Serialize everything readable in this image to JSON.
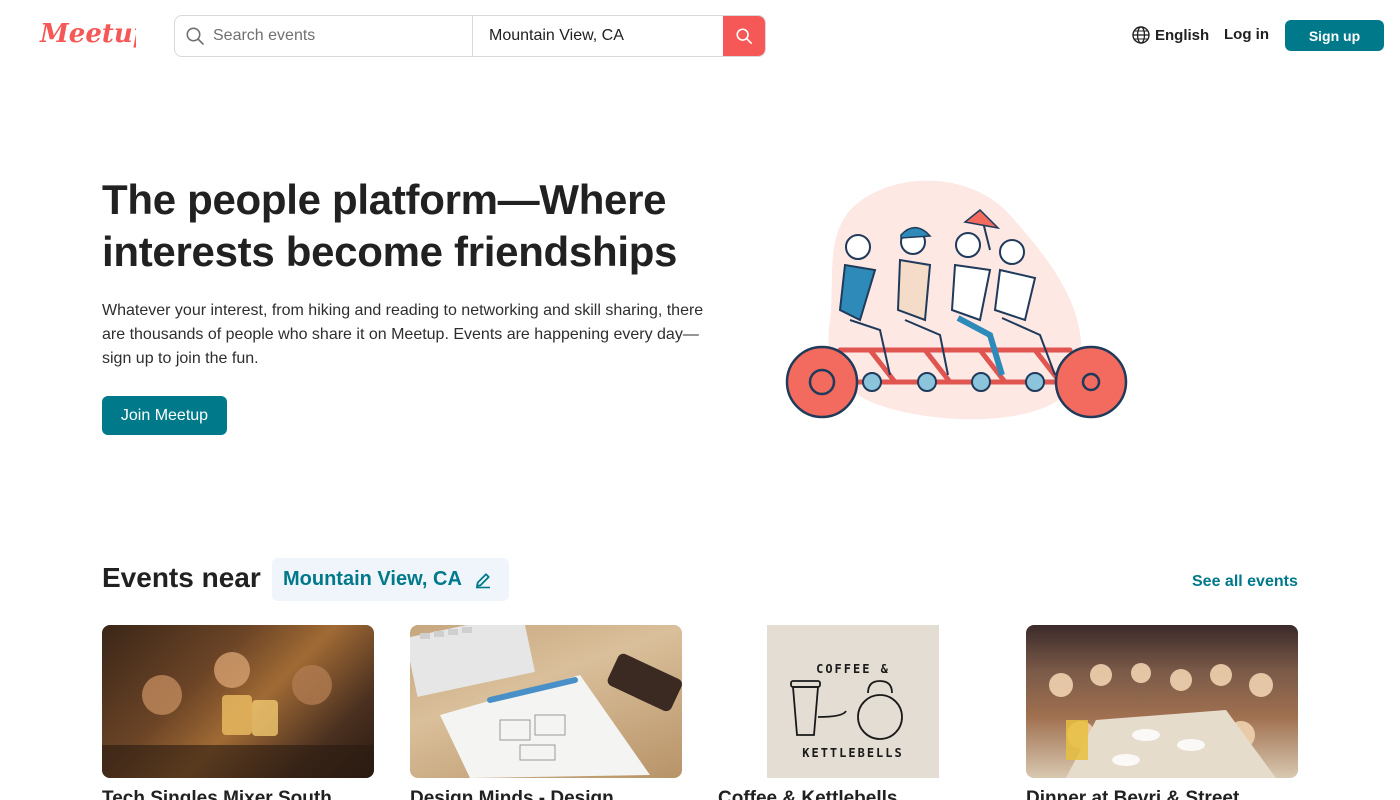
{
  "header": {
    "logo_text": "Meetup",
    "search_placeholder": "Search events",
    "location_value": "Mountain View, CA",
    "language_label": "English",
    "login_label": "Log in",
    "signup_label": "Sign up"
  },
  "hero": {
    "title": "The people platform—Where interests become friendships",
    "subtitle": "Whatever your interest, from hiking and reading to networking and skill sharing, there are thousands of people who share it on Meetup. Events are happening every day—sign up to join the fun.",
    "cta_label": "Join Meetup"
  },
  "events": {
    "heading": "Events near",
    "location": "Mountain View, CA",
    "see_all_label": "See all events",
    "cards": [
      {
        "title": "Tech Singles Mixer South"
      },
      {
        "title": "Design Minds - Design"
      },
      {
        "title": "Coffee & Kettlebells",
        "image_text_top": "COFFEE &",
        "image_text_bottom": "KETTLEBELLS"
      },
      {
        "title": "Dinner at Bevri & Street"
      }
    ]
  },
  "colors": {
    "brand_red": "#f65858",
    "brand_teal": "#00798a",
    "chip_bg": "#f0f5fb"
  },
  "icons": [
    "meetup-logo",
    "search-icon",
    "globe-icon",
    "pencil-icon"
  ]
}
